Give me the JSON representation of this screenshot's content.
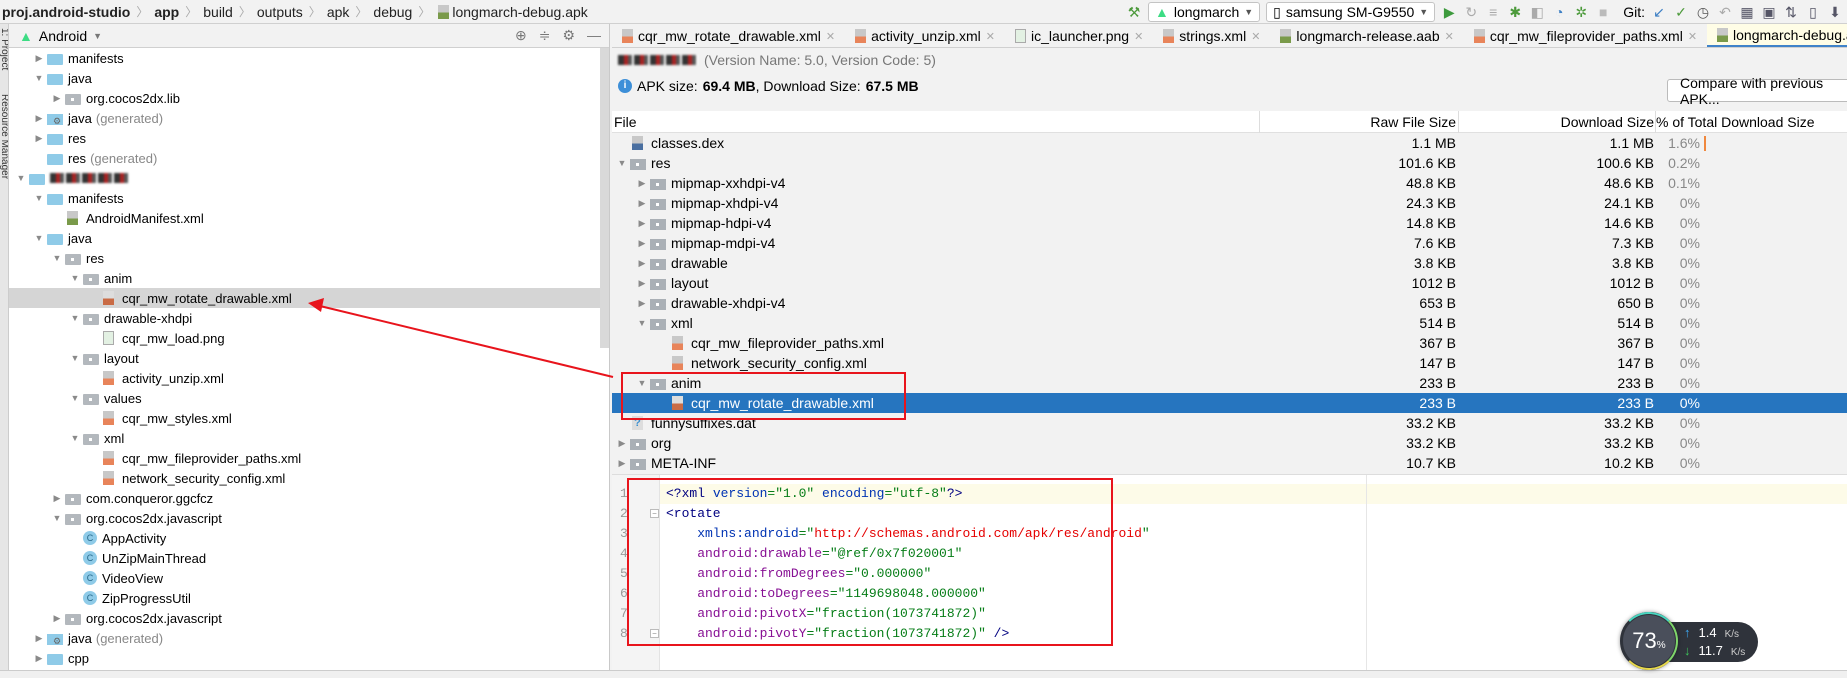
{
  "breadcrumb": [
    {
      "label": "proj.android-studio",
      "bold": true
    },
    {
      "label": "app",
      "bold": true
    },
    {
      "label": "build"
    },
    {
      "label": "outputs"
    },
    {
      "label": "apk"
    },
    {
      "label": "debug"
    },
    {
      "label": "longmarch-debug.apk",
      "icon": "apk-file-icon"
    }
  ],
  "toolbar": {
    "config": "longmarch",
    "device": "samsung SM-G9550",
    "git_label": "Git:"
  },
  "side_stripe": {
    "project": "1: Project",
    "resource_manager": "Resource Manager"
  },
  "project_panel": {
    "view_mode": "Android",
    "tree": [
      {
        "label": "manifests",
        "level": 1,
        "arrow": "collapsed",
        "icon": "folder"
      },
      {
        "label": "java",
        "level": 1,
        "arrow": "expanded",
        "icon": "folder"
      },
      {
        "label": "org.cocos2dx.lib",
        "level": 2,
        "arrow": "collapsed",
        "icon": "package"
      },
      {
        "label": "java",
        "suffix": "(generated)",
        "level": 1,
        "arrow": "collapsed",
        "icon": "generated"
      },
      {
        "label": "res",
        "level": 1,
        "arrow": "collapsed",
        "icon": "folder"
      },
      {
        "label": "res",
        "suffix": "(generated)",
        "level": 1,
        "arrow": "none",
        "icon": "folder"
      },
      {
        "label": "",
        "blurred": true,
        "level": 0,
        "arrow": "expanded",
        "icon": "module"
      },
      {
        "label": "manifests",
        "level": 1,
        "arrow": "expanded",
        "icon": "folder"
      },
      {
        "label": "AndroidManifest.xml",
        "level": 2,
        "arrow": "none",
        "icon": "manifest"
      },
      {
        "label": "java",
        "level": 1,
        "arrow": "expanded",
        "icon": "folder"
      },
      {
        "label": "res",
        "level": 2,
        "arrow": "expanded",
        "icon": "package"
      },
      {
        "label": "anim",
        "level": 3,
        "arrow": "expanded",
        "icon": "package"
      },
      {
        "label": "cqr_mw_rotate_drawable.xml",
        "level": 4,
        "arrow": "none",
        "icon": "xml",
        "selected": true
      },
      {
        "label": "drawable-xhdpi",
        "level": 3,
        "arrow": "expanded",
        "icon": "package"
      },
      {
        "label": "cqr_mw_load.png",
        "level": 4,
        "arrow": "none",
        "icon": "png"
      },
      {
        "label": "layout",
        "level": 3,
        "arrow": "expanded",
        "icon": "package"
      },
      {
        "label": "activity_unzip.xml",
        "level": 4,
        "arrow": "none",
        "icon": "xml"
      },
      {
        "label": "values",
        "level": 3,
        "arrow": "expanded",
        "icon": "package"
      },
      {
        "label": "cqr_mw_styles.xml",
        "level": 4,
        "arrow": "none",
        "icon": "xml"
      },
      {
        "label": "xml",
        "level": 3,
        "arrow": "expanded",
        "icon": "package"
      },
      {
        "label": "cqr_mw_fileprovider_paths.xml",
        "level": 4,
        "arrow": "none",
        "icon": "xml"
      },
      {
        "label": "network_security_config.xml",
        "level": 4,
        "arrow": "none",
        "icon": "xml"
      },
      {
        "label": "com.conqueror.ggcfcz",
        "level": 2,
        "arrow": "collapsed",
        "icon": "package"
      },
      {
        "label": "org.cocos2dx.javascript",
        "level": 2,
        "arrow": "expanded",
        "icon": "package"
      },
      {
        "label": "AppActivity",
        "level": 3,
        "arrow": "none",
        "icon": "class"
      },
      {
        "label": "UnZipMainThread",
        "level": 3,
        "arrow": "none",
        "icon": "class"
      },
      {
        "label": "VideoView",
        "level": 3,
        "arrow": "none",
        "icon": "class"
      },
      {
        "label": "ZipProgressUtil",
        "level": 3,
        "arrow": "none",
        "icon": "class"
      },
      {
        "label": "org.cocos2dx.javascript",
        "level": 2,
        "arrow": "collapsed",
        "icon": "package"
      },
      {
        "label": "java",
        "suffix": "(generated)",
        "level": 1,
        "arrow": "collapsed",
        "icon": "generated"
      },
      {
        "label": "cpp",
        "level": 1,
        "arrow": "collapsed",
        "icon": "folder"
      }
    ]
  },
  "tabs": [
    {
      "label": "cqr_mw_rotate_drawable.xml",
      "icon": "xml"
    },
    {
      "label": "activity_unzip.xml",
      "icon": "xml"
    },
    {
      "label": "ic_launcher.png",
      "icon": "png"
    },
    {
      "label": "strings.xml",
      "icon": "xml"
    },
    {
      "label": "longmarch-release.aab",
      "icon": "apk"
    },
    {
      "label": "cqr_mw_fileprovider_paths.xml",
      "icon": "xml"
    },
    {
      "label": "longmarch-debug.apk",
      "icon": "apk",
      "active": true,
      "blurred_prefix": true
    }
  ],
  "apk": {
    "version_info": "(Version Name: 5.0, Version Code: 5)",
    "apk_size_label": "APK size:",
    "apk_size": "69.4 MB",
    "download_size_label": ", Download Size:",
    "download_size": "67.5 MB",
    "compare_button": "Compare with previous APK..."
  },
  "table": {
    "columns": [
      "File",
      "Raw File Size",
      "Download Size",
      "% of Total Download Size"
    ],
    "rows": [
      {
        "name": "classes.dex",
        "level": 0,
        "arrow": "none",
        "icon": "dex",
        "raw": "1.1 MB",
        "download": "1.1 MB",
        "pct": "1.6%",
        "pct_value": 1.6
      },
      {
        "name": "res",
        "level": 0,
        "arrow": "expanded",
        "icon": "folder",
        "raw": "101.6 KB",
        "download": "100.6 KB",
        "pct": "0.2%"
      },
      {
        "name": "mipmap-xxhdpi-v4",
        "level": 1,
        "arrow": "collapsed",
        "icon": "folder",
        "raw": "48.8 KB",
        "download": "48.6 KB",
        "pct": "0.1%"
      },
      {
        "name": "mipmap-xhdpi-v4",
        "level": 1,
        "arrow": "collapsed",
        "icon": "folder",
        "raw": "24.3 KB",
        "download": "24.1 KB",
        "pct": "0%"
      },
      {
        "name": "mipmap-hdpi-v4",
        "level": 1,
        "arrow": "collapsed",
        "icon": "folder",
        "raw": "14.8 KB",
        "download": "14.6 KB",
        "pct": "0%"
      },
      {
        "name": "mipmap-mdpi-v4",
        "level": 1,
        "arrow": "collapsed",
        "icon": "folder",
        "raw": "7.6 KB",
        "download": "7.3 KB",
        "pct": "0%"
      },
      {
        "name": "drawable",
        "level": 1,
        "arrow": "collapsed",
        "icon": "folder",
        "raw": "3.8 KB",
        "download": "3.8 KB",
        "pct": "0%"
      },
      {
        "name": "layout",
        "level": 1,
        "arrow": "collapsed",
        "icon": "folder",
        "raw": "1012 B",
        "download": "1012 B",
        "pct": "0%"
      },
      {
        "name": "drawable-xhdpi-v4",
        "level": 1,
        "arrow": "collapsed",
        "icon": "folder",
        "raw": "653 B",
        "download": "650 B",
        "pct": "0%"
      },
      {
        "name": "xml",
        "level": 1,
        "arrow": "expanded",
        "icon": "folder",
        "raw": "514 B",
        "download": "514 B",
        "pct": "0%"
      },
      {
        "name": "cqr_mw_fileprovider_paths.xml",
        "level": 2,
        "arrow": "none",
        "icon": "xml",
        "raw": "367 B",
        "download": "367 B",
        "pct": "0%"
      },
      {
        "name": "network_security_config.xml",
        "level": 2,
        "arrow": "none",
        "icon": "xml",
        "raw": "147 B",
        "download": "147 B",
        "pct": "0%"
      },
      {
        "name": "anim",
        "level": 1,
        "arrow": "expanded",
        "icon": "folder",
        "raw": "233 B",
        "download": "233 B",
        "pct": "0%"
      },
      {
        "name": "cqr_mw_rotate_drawable.xml",
        "level": 2,
        "arrow": "none",
        "icon": "xml",
        "raw": "233 B",
        "download": "233 B",
        "pct": "0%",
        "selected": true
      },
      {
        "name": "funnysuffixes.dat",
        "level": 0,
        "arrow": "none",
        "icon": "dat",
        "raw": "33.2 KB",
        "download": "33.2 KB",
        "pct": "0%"
      },
      {
        "name": "org",
        "level": 0,
        "arrow": "collapsed",
        "icon": "folder",
        "raw": "33.2 KB",
        "download": "33.2 KB",
        "pct": "0%"
      },
      {
        "name": "META-INF",
        "level": 0,
        "arrow": "collapsed",
        "icon": "folder",
        "raw": "10.7 KB",
        "download": "10.2 KB",
        "pct": "0%"
      }
    ]
  },
  "code": {
    "lines": [
      [
        [
          "<?xml ",
          "tag"
        ],
        [
          "version",
          "attr"
        ],
        [
          "=\"1.0\" ",
          "val"
        ],
        [
          "encoding",
          "attr"
        ],
        [
          "=\"utf-8\"",
          "val"
        ],
        [
          "?>",
          "tag"
        ]
      ],
      [
        [
          "<rotate",
          "tag"
        ]
      ],
      [
        [
          "    xmlns:android",
          "attr"
        ],
        [
          "=\"",
          "val"
        ],
        [
          "http://schemas.android.com/apk/res/android",
          "url"
        ],
        [
          "\"",
          "val"
        ]
      ],
      [
        [
          "    android:drawable",
          "ns"
        ],
        [
          "=\"@ref/0x7f020001\"",
          "val"
        ]
      ],
      [
        [
          "    android:fromDegrees",
          "ns"
        ],
        [
          "=\"0.000000\"",
          "val"
        ]
      ],
      [
        [
          "    android:toDegrees",
          "ns"
        ],
        [
          "=\"1149698048.000000\"",
          "val"
        ]
      ],
      [
        [
          "    android:pivotX",
          "ns"
        ],
        [
          "=\"fraction(1073741872)\"",
          "val"
        ]
      ],
      [
        [
          "    android:pivotY",
          "ns"
        ],
        [
          "=\"fraction(1073741872)\" ",
          "val"
        ],
        [
          "/>",
          "tag"
        ]
      ]
    ]
  },
  "net_widget": {
    "percent": "73",
    "percent_sign": "%",
    "up": "1.4",
    "down": "11.7",
    "unit": "K/s"
  },
  "colors": {
    "selection": "#2675bf",
    "annotation": "#e8141c",
    "active_tab_underline": "#4083c9",
    "pct_bar": "#f0883e"
  }
}
